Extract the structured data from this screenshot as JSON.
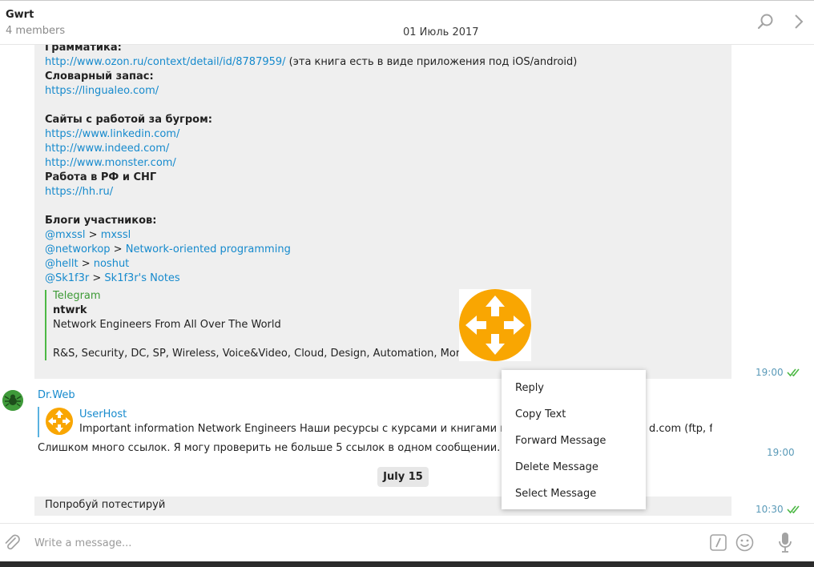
{
  "header": {
    "title": "Gwrt",
    "members": "4 members",
    "date": "01 Июль 2017",
    "search_icon": "search-icon",
    "more_icon": "chevron-right-icon"
  },
  "message1": {
    "lines": [
      {
        "text": "Грамматика:",
        "style": "bold"
      },
      {
        "text": "http://www.ozon.ru/context/detail/id/8787959/",
        "suffix": " (эта книга есть в виде приложения под iOS/android)",
        "style": "link"
      },
      {
        "text": "Словарный запас:",
        "style": "bold"
      },
      {
        "text": "https://lingualeo.com/",
        "style": "link"
      },
      {
        "text": "Сайты с работой за бугром:",
        "style": "bold"
      },
      {
        "text": "https://www.linkedin.com/",
        "style": "link"
      },
      {
        "text": "http://www.indeed.com/",
        "style": "link"
      },
      {
        "text": "http://www.monster.com/",
        "style": "link"
      },
      {
        "text": "Работа в РФ и СНГ",
        "style": "bold"
      },
      {
        "text": "https://hh.ru/",
        "style": "link"
      },
      {
        "text": "Блоги участников:",
        "style": "bold"
      }
    ],
    "blogs": [
      {
        "user": "@mxssl",
        "sep": " > ",
        "name": "mxssl"
      },
      {
        "user": "@networkop",
        "sep": " > ",
        "name": "Network-oriented programming"
      },
      {
        "user": "@hellt",
        "sep": " > ",
        "name": "noshut"
      },
      {
        "user": "@Sk1f3r",
        "sep": " > ",
        "name": "Sk1f3r's Notes"
      }
    ],
    "preview": {
      "site": "Telegram",
      "title": "ntwrk",
      "desc": "Network Engineers From All Over The World",
      "tags": "R&S, Security, DC, SP, Wireless, Voice&Video, Cloud, Design, Automation, Monitorin...",
      "image_icon": "router-icon"
    },
    "time": "19:00",
    "status": "read"
  },
  "message2": {
    "sender": "Dr.Web",
    "avatar_icon": "drweb-spider-icon",
    "forward": {
      "name": "UserHost",
      "text": "Important information Network Engineers Наши ресурсы с курсами и книгами по сетям",
      "text_tail": "d.com (ftp, f..."
    },
    "text": "Слишком много ссылок. Я могу проверить не больше 5 ссылок в одном сообщении.",
    "time": "19:00"
  },
  "date_separator": "July 15",
  "message3": {
    "text": "Попробуй потестируй",
    "time": "10:30",
    "status": "read"
  },
  "context_menu": {
    "items": [
      "Reply",
      "Copy Text",
      "Forward Message",
      "Delete Message",
      "Select Message"
    ]
  },
  "composer": {
    "placeholder": "Write a message...",
    "attach_icon": "paperclip-icon",
    "commands_icon": "slash-commands-icon",
    "emoji_icon": "emoji-icon",
    "mic_icon": "microphone-icon"
  },
  "colors": {
    "link": "#168acd",
    "bubble": "#efefef",
    "preview_bar": "#4cb844",
    "router_orange": "#f9a602",
    "check_green": "#4cb844"
  }
}
